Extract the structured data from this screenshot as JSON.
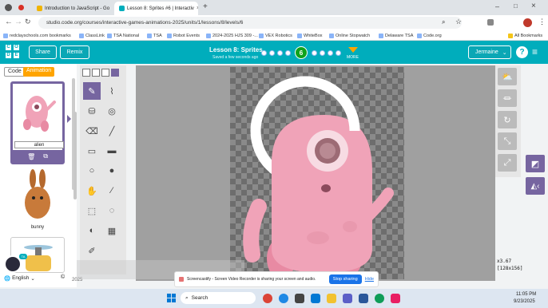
{
  "browser": {
    "tabs": [
      {
        "label": "Introduction to JavaScript - Go"
      },
      {
        "label": "Lesson 8: Sprites #6 | Interactiv"
      }
    ],
    "url": "studio.code.org/courses/interactive-games-animations-2025/units/1/lessons/8/levels/6",
    "bookmarks": [
      "redclayschools.com bookmarks",
      "ClassLink",
      "TSA National",
      "TSA",
      "Robot Events",
      "2024-2025 HJS 309 -...",
      "VEX Robotics",
      "WhiteBox",
      "Online Stopwatch",
      "Delaware TSA",
      "Code.org"
    ],
    "all_bookmarks": "All Bookmarks"
  },
  "header": {
    "logo": [
      "C",
      "O",
      "D",
      "E"
    ],
    "share": "Share",
    "remix": "Remix",
    "lesson_title": "Lesson 8: Sprites",
    "saved": "Saved a few seconds ago",
    "current_level": "6",
    "more": "MORE",
    "user": "Jermaine",
    "menu_icon": "hamburger-icon"
  },
  "left": {
    "code_tab": "Code",
    "animation_tab": "Animation",
    "sprites": [
      {
        "name": "alien",
        "selected": true
      },
      {
        "name": "bunny",
        "selected": false
      }
    ],
    "language": "English"
  },
  "status": {
    "zoom": "x3.67",
    "size": "[128x156]"
  },
  "notification": {
    "text": "Screencastify - Screen Video Recorder is sharing your screen and audio.",
    "stop": "Stop sharing",
    "hide": "Hide"
  },
  "taskbar": {
    "search": "Search",
    "time": "11:05 PM",
    "date": "9/23/2025"
  },
  "year": "2025",
  "colors": {
    "teal": "#00adbc",
    "purple": "#7665a0",
    "orange": "#ffa400",
    "level_green": "#0fa31c"
  }
}
